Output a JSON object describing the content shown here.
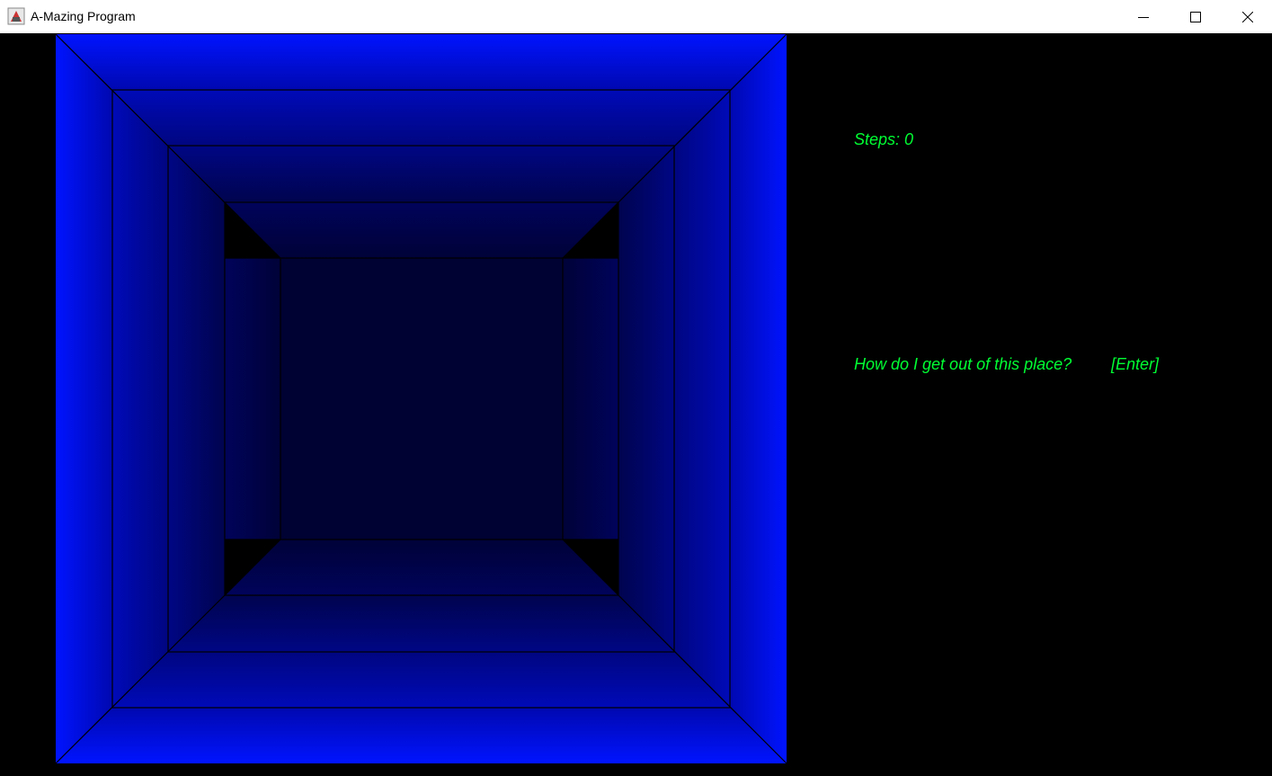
{
  "window": {
    "title": "A-Mazing Program",
    "icon": "java-app-icon",
    "controls": [
      "minimize-icon",
      "maximize-icon",
      "close-icon"
    ]
  },
  "hud": {
    "steps": "Steps: 0",
    "prompt": "How do I get out of this place?",
    "enter_hint": "[Enter]"
  },
  "colors": {
    "wall_bright": "#0000ff",
    "wall_dark": "#000033",
    "text": "#00ff33",
    "background": "#000000"
  }
}
